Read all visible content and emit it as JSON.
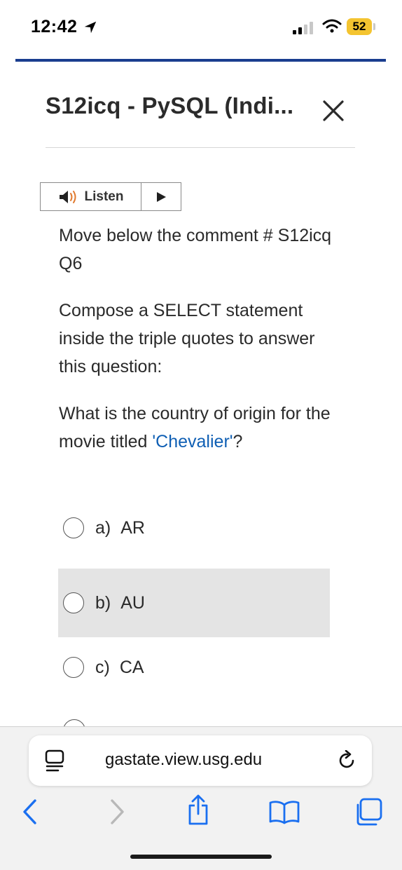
{
  "status_bar": {
    "time": "12:42",
    "battery": "52"
  },
  "dialog": {
    "title": "S12icq - PySQL (Indi..."
  },
  "listen": {
    "label": "Listen"
  },
  "question": {
    "p1": "Move below the comment # S12icq Q6",
    "p2": "Compose a SELECT statement inside the triple quotes to answer this question:",
    "p3_prefix": "What is the country of origin for the movie titled ",
    "p3_highlight": "'Chevalier'",
    "p3_suffix": "?"
  },
  "options": [
    {
      "letter": "a)",
      "value": "AR"
    },
    {
      "letter": "b)",
      "value": "AU"
    },
    {
      "letter": "c)",
      "value": "CA"
    }
  ],
  "browser": {
    "url": "gastate.view.usg.edu"
  },
  "colors": {
    "accent_rule": "#1a3d8f",
    "link": "#0f5fb4",
    "battery": "#f4c430",
    "option_hover": "#e4e4e4"
  },
  "icons": [
    "location-arrow-icon",
    "signal-icon",
    "wifi-icon",
    "battery-icon",
    "close-icon",
    "speaker-icon",
    "play-icon",
    "reader-icon",
    "reload-icon",
    "back-icon",
    "forward-icon",
    "share-icon",
    "bookmarks-icon",
    "tabs-icon"
  ]
}
